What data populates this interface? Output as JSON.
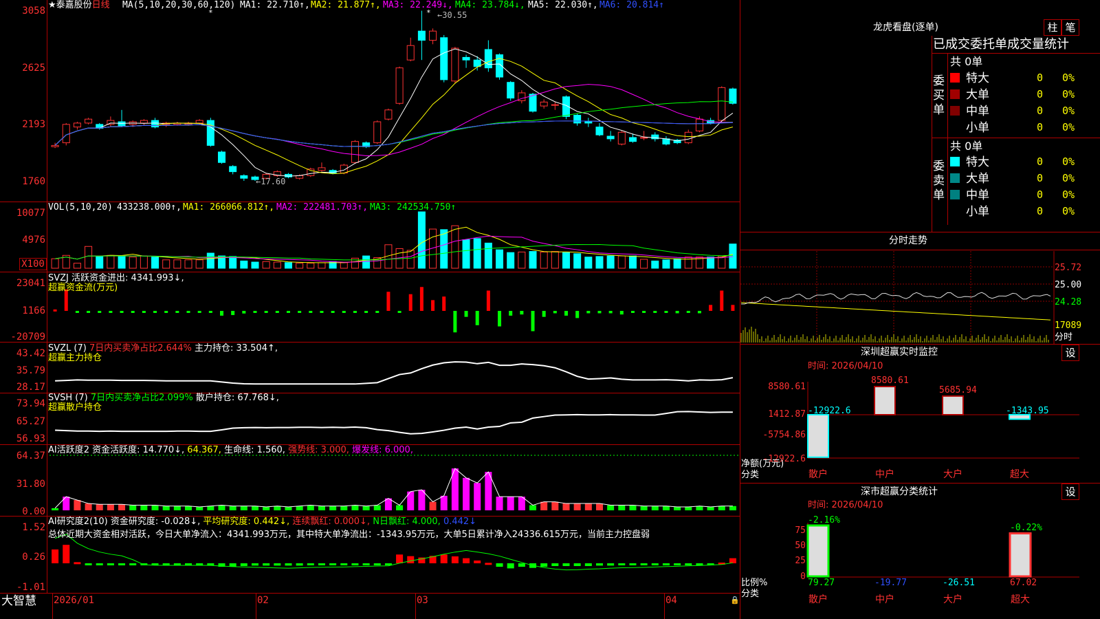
{
  "main": {
    "ma_header": {
      "star": "★",
      "name": "泰嘉股份",
      "period": "日线",
      "ma_spec": "MA(5,10,20,30,60,120)",
      "ma1": "MA1: 22.710↑,",
      "ma2": "MA2: 21.877↑,",
      "ma3": "MA3: 22.249↓,",
      "ma4": "MA4: 23.784↓,",
      "ma5": "MA5: 22.030↑,",
      "ma6": "MA6: 20.814↑"
    },
    "price_ticks": [
      "3058",
      "2625",
      "2193",
      "1760"
    ],
    "high_label": "30.55",
    "low_label": "←17.60",
    "vol_header": {
      "spec": "VOL(5,10,20)",
      "val": "433238.000↑,",
      "ma1": "MA1: 266066.812↑,",
      "ma2": "MA2: 222481.703↑,",
      "ma3": "MA3: 242534.750↑"
    },
    "vol_ticks": [
      "10077",
      "4976",
      "X100"
    ],
    "svzj": {
      "l1": "SVZJ  活跃资金进出: 4341.993↓,",
      "l2": "超赢资金流(万元)",
      "ticks": [
        "23041",
        "1166",
        "-20709"
      ]
    },
    "svzl": {
      "l1a": "SVZL (7)",
      "l1b": "7日内买卖净占比2.644%",
      "l1c": "主力持仓: 33.504↑,",
      "l2": "超赢主力持仓",
      "ticks": [
        "43.42",
        "35.79",
        "28.17"
      ]
    },
    "svsh": {
      "l1a": "SVSH (7)",
      "l1b": "7日内买卖净占比2.099%",
      "l1c": "散户持仓: 67.768↓,",
      "l2": "超赢散户持仓",
      "ticks": [
        "73.94",
        "65.27",
        "56.93"
      ]
    },
    "ai2": {
      "a": "AI活跃度2 资金活跃度: 14.770↓,",
      "b": "64.367,",
      "c": "生命线: 1.560,",
      "d": "强势线: 3.000,",
      "e": "爆发线: 6.000,",
      "ticks": [
        "64.37",
        "31.80",
        "0.00"
      ]
    },
    "ai_r": {
      "a": "AI研究度2(10) 资金研究度: -0.028↓,",
      "b": "平均研究度: 0.442↓,",
      "c": "连续飘红: 0.000↓,",
      "d": "N日飘红: 4.000,",
      "e": "0.442↓",
      "summary": "总体近期大资金相对活跃，今日大单净流入：4341.993万元，其中特大单净流出：-1343.95万元，大单5日累计净入24336.615万元，当前主力控盘弱",
      "ticks": [
        "1.52",
        "0.26",
        "-1.01"
      ]
    },
    "dates": [
      "2026/01",
      "02",
      "03",
      "04"
    ],
    "brand": "大智慧"
  },
  "right": {
    "lhb_title": "龙虎看盘(逐单)",
    "btn_zhu": "柱",
    "btn_bi": "笔",
    "stats_title": "已成交委托单成交量统计",
    "buy": {
      "side": "委买单",
      "total": "共 0单",
      "rows": [
        {
          "name": "特大",
          "n": "0",
          "p": "0%",
          "color": "#ff0000"
        },
        {
          "name": "大单",
          "n": "0",
          "p": "0%",
          "color": "#a00000"
        },
        {
          "name": "中单",
          "n": "0",
          "p": "0%",
          "color": "#800000"
        },
        {
          "name": "小单",
          "n": "0",
          "p": "0%",
          "color": ""
        }
      ]
    },
    "sell": {
      "side": "委卖单",
      "total": "共 0单",
      "rows": [
        {
          "name": "特大",
          "n": "0",
          "p": "0%",
          "color": "#00ffff"
        },
        {
          "name": "大单",
          "n": "0",
          "p": "0%",
          "color": "#008888"
        },
        {
          "name": "中单",
          "n": "0",
          "p": "0%",
          "color": "#008080"
        },
        {
          "name": "小单",
          "n": "0",
          "p": "0%",
          "color": ""
        }
      ]
    },
    "fenshi": {
      "title": "分时走势",
      "ticks": [
        "25.72",
        "25.00",
        "24.28",
        "17089"
      ],
      "label": "分时"
    },
    "monitor": {
      "title": "深圳超赢实时监控",
      "time": "时间: 2026/04/10",
      "btn": "设",
      "yticks": [
        "8580.61",
        "1412.87",
        "-5754.86",
        "-12922.6"
      ],
      "bars": [
        {
          "cat": "散户",
          "v": -12922.6,
          "label": "-12922.6"
        },
        {
          "cat": "中户",
          "v": 8580.61,
          "label": "8580.61"
        },
        {
          "cat": "大户",
          "v": 5685.94,
          "label": "5685.94"
        },
        {
          "cat": "超大",
          "v": -1343.95,
          "label": "-1343.95"
        }
      ],
      "ylabel": "净额(万元)",
      "xlabel": "分类"
    },
    "classify": {
      "title": "深市超赢分类统计",
      "time": "时间: 2026/04/10",
      "btn": "设",
      "yticks": [
        "75",
        "50",
        "25",
        "0"
      ],
      "bars": [
        {
          "cat": "散户",
          "top": "-2.16%",
          "v": 79.27,
          "label": "79.27"
        },
        {
          "cat": "中户",
          "top": "",
          "v": -19.77,
          "label": "-19.77"
        },
        {
          "cat": "大户",
          "top": "",
          "v": -26.51,
          "label": "-26.51"
        },
        {
          "cat": "超大",
          "top": "-0.22%",
          "v": 67.02,
          "label": "67.02"
        }
      ],
      "ylabel": "比例%",
      "xlabel": "分类"
    }
  },
  "chart_data": {
    "type": "candlestick",
    "ma_spec": [
      5,
      10,
      20,
      30,
      60,
      120
    ],
    "candles": [
      [
        20.2,
        20.3,
        20.1,
        20.5
      ],
      [
        20.5,
        21.9,
        20.3,
        22.0
      ],
      [
        21.7,
        22.0,
        21.5,
        22.1
      ],
      [
        22.0,
        22.3,
        21.9,
        22.4
      ],
      [
        21.9,
        21.6,
        21.5,
        22.0
      ],
      [
        21.9,
        22.2,
        21.7,
        22.5
      ],
      [
        22.1,
        21.8,
        21.7,
        23.0
      ],
      [
        21.9,
        22.1,
        21.7,
        22.2
      ],
      [
        22.0,
        22.2,
        21.8,
        22.3
      ],
      [
        22.2,
        21.7,
        21.6,
        22.4
      ],
      [
        21.9,
        22.0,
        21.7,
        22.1
      ],
      [
        21.9,
        22.0,
        21.8,
        22.1
      ],
      [
        21.9,
        22.0,
        21.8,
        22.1
      ],
      [
        22.0,
        22.2,
        21.9,
        22.3
      ],
      [
        22.2,
        20.3,
        20.2,
        22.4
      ],
      [
        19.8,
        19.0,
        18.9,
        19.9
      ],
      [
        18.7,
        18.3,
        18.1,
        18.8
      ],
      [
        18.0,
        17.8,
        17.6,
        18.1
      ],
      [
        17.9,
        17.7,
        17.6,
        18.0
      ],
      [
        17.8,
        18.1,
        17.7,
        18.2
      ],
      [
        18.0,
        18.3,
        17.9,
        18.4
      ],
      [
        18.1,
        17.9,
        17.8,
        18.2
      ],
      [
        17.8,
        18.0,
        17.7,
        18.1
      ],
      [
        18.0,
        18.5,
        17.9,
        18.6
      ],
      [
        18.4,
        18.6,
        18.3,
        19.0
      ],
      [
        18.4,
        18.2,
        18.1,
        18.5
      ],
      [
        18.2,
        18.8,
        18.1,
        18.9
      ],
      [
        19.0,
        20.6,
        18.9,
        20.7
      ],
      [
        20.5,
        20.2,
        20.1,
        20.6
      ],
      [
        20.5,
        22.1,
        20.4,
        22.2
      ],
      [
        22.3,
        23.0,
        22.2,
        23.1
      ],
      [
        23.5,
        26.2,
        23.4,
        26.3
      ],
      [
        26.8,
        27.9,
        26.7,
        28.5
      ],
      [
        29.0,
        28.3,
        26.8,
        30.55
      ],
      [
        28.3,
        29.0,
        28.0,
        29.2
      ],
      [
        28.5,
        25.3,
        25.1,
        28.7
      ],
      [
        25.2,
        27.7,
        25.0,
        27.8
      ],
      [
        27.0,
        26.8,
        26.2,
        27.2
      ],
      [
        26.8,
        26.3,
        26.0,
        27.1
      ],
      [
        27.6,
        26.2,
        25.9,
        28.3
      ],
      [
        27.2,
        25.5,
        25.3,
        27.3
      ],
      [
        25.1,
        23.9,
        23.7,
        25.2
      ],
      [
        23.7,
        24.3,
        23.5,
        24.5
      ],
      [
        24.2,
        22.9,
        22.8,
        24.3
      ],
      [
        23.3,
        23.6,
        23.1,
        23.8
      ],
      [
        23.4,
        23.4,
        23.0,
        23.6
      ],
      [
        24.0,
        22.5,
        22.3,
        24.1
      ],
      [
        22.6,
        22.0,
        21.8,
        22.7
      ],
      [
        22.1,
        22.0,
        21.7,
        22.4
      ],
      [
        21.7,
        21.1,
        21.0,
        22.0
      ],
      [
        21.0,
        20.8,
        20.6,
        21.4
      ],
      [
        20.4,
        21.3,
        20.3,
        21.4
      ],
      [
        20.9,
        20.6,
        20.5,
        21.2
      ],
      [
        20.9,
        20.9,
        20.7,
        21.4
      ],
      [
        21.1,
        20.8,
        20.6,
        21.3
      ],
      [
        20.8,
        20.4,
        20.3,
        21.0
      ],
      [
        20.7,
        20.5,
        20.4,
        20.8
      ],
      [
        20.5,
        21.3,
        20.4,
        21.5
      ],
      [
        21.4,
        22.3,
        21.3,
        22.5
      ],
      [
        22.2,
        22.0,
        21.9,
        22.4
      ],
      [
        22.2,
        24.7,
        22.1,
        24.8
      ],
      [
        24.6,
        23.5,
        23.4,
        24.7
      ]
    ],
    "volume_x100": [
      1700,
      2300,
      900,
      3900,
      2100,
      2300,
      2200,
      2000,
      2200,
      2000,
      1500,
      1500,
      1500,
      1500,
      2700,
      2200,
      2100,
      1300,
      1100,
      1200,
      1100,
      1000,
      900,
      900,
      1000,
      1200,
      1000,
      1800,
      2200,
      1900,
      4200,
      3500,
      3200,
      10077,
      7000,
      6900,
      7600,
      5100,
      5300,
      4500,
      3300,
      2800,
      2900,
      3000,
      2900,
      3000,
      2800,
      2600,
      2000,
      2100,
      2200,
      2200,
      2200,
      1600,
      1300,
      1500,
      1700,
      2000,
      2000,
      2000,
      2200,
      4333
    ],
    "money_flow": [
      1200,
      18000,
      -1500,
      -1200,
      -800,
      -900,
      -500,
      -1000,
      -700,
      -800,
      -600,
      -500,
      -600,
      -500,
      -400,
      -4000,
      -3500,
      -2200,
      -800,
      -500,
      -600,
      -500,
      -500,
      -600,
      -400,
      -500,
      -500,
      -700,
      -500,
      -600,
      16000,
      -1000,
      14000,
      20000,
      9000,
      12000,
      -18000,
      -5000,
      -12000,
      17000,
      -13000,
      -4000,
      -3000,
      -17000,
      -5000,
      -2000,
      -4000,
      -6000,
      -2000,
      -2000,
      -2000,
      -3000,
      -1500,
      -1500,
      -1500,
      -1000,
      -2000,
      -1000,
      -2000,
      5000,
      17000,
      5000
    ],
    "main_hold": [
      31.0,
      31.2,
      31.4,
      31.3,
      31.3,
      31.3,
      31.2,
      31.2,
      31.2,
      31.1,
      31.0,
      31.0,
      31.0,
      31.0,
      31.0,
      30.5,
      30.0,
      29.7,
      29.6,
      29.6,
      29.6,
      29.6,
      29.6,
      29.6,
      29.6,
      29.6,
      29.6,
      29.6,
      29.9,
      30.2,
      32.0,
      33.8,
      34.5,
      36.4,
      38.0,
      39.0,
      39.4,
      39.3,
      38.6,
      39.2,
      37.9,
      37.9,
      38.5,
      38.2,
      37.7,
      36.8,
      35.0,
      33.0,
      31.8,
      32.0,
      32.3,
      31.7,
      31.4,
      31.4,
      31.4,
      31.5,
      31.3,
      31.0,
      31.4,
      31.3,
      31.5,
      32.4,
      33.5,
      33.4,
      33.5
    ],
    "retail_hold": [
      61.0,
      60.8,
      60.6,
      60.6,
      60.5,
      60.6,
      60.5,
      60.5,
      60.5,
      60.5,
      60.5,
      60.6,
      60.6,
      60.5,
      60.5,
      61.2,
      62.0,
      62.2,
      62.3,
      62.2,
      62.3,
      62.3,
      62.4,
      62.4,
      62.3,
      62.4,
      62.3,
      62.5,
      62.2,
      61.3,
      60.8,
      60.0,
      59.3,
      59.5,
      60.2,
      61.0,
      62.0,
      62.5,
      61.6,
      62.5,
      62.8,
      64.5,
      64.8,
      66.8,
      67.5,
      68.2,
      68.3,
      68.4,
      68.3,
      68.3,
      68.4,
      68.3,
      68.3,
      68.2,
      68.2,
      69.0,
      69.8,
      69.9,
      69.7,
      69.5,
      69.6,
      69.6,
      69.4,
      69.2,
      70.2,
      69.8,
      67.8
    ],
    "activity": [
      2.5,
      16,
      12,
      8,
      7,
      7,
      7,
      6,
      6,
      6,
      5,
      5,
      5,
      4,
      5,
      6,
      5,
      5,
      5,
      4,
      5,
      4,
      5,
      6,
      5,
      5,
      5,
      6,
      5,
      6,
      14,
      6,
      22,
      24,
      10,
      17,
      49,
      38,
      32,
      45,
      16,
      16,
      16,
      6,
      10,
      10,
      8,
      8,
      8,
      8,
      6,
      6,
      6,
      5,
      5,
      5,
      4,
      4,
      5,
      4,
      5,
      5,
      14,
      14
    ],
    "research": [
      0.6,
      0.8,
      0.05,
      -0.04,
      -0.05,
      -0.05,
      -0.05,
      -0.05,
      -0.05,
      -0.05,
      -0.05,
      -0.05,
      -0.05,
      -0.05,
      -0.06,
      -0.15,
      -0.15,
      -0.12,
      -0.1,
      -0.1,
      -0.1,
      -0.1,
      -0.1,
      -0.08,
      -0.08,
      -0.08,
      -0.08,
      -0.05,
      -0.05,
      -0.05,
      -0.05,
      0.38,
      0.31,
      0.25,
      0.32,
      0.38,
      0.3,
      0.22,
      0.12,
      0.02,
      -0.15,
      -0.22,
      -0.15,
      -0.2,
      -0.15,
      -0.12,
      -0.12,
      -0.12,
      -0.12,
      -0.1,
      -0.1,
      -0.08,
      -0.08,
      -0.08,
      -0.06,
      -0.05,
      -0.05,
      -0.04,
      -0.02,
      -0.01,
      0.03,
      0.22,
      -0.03
    ]
  }
}
